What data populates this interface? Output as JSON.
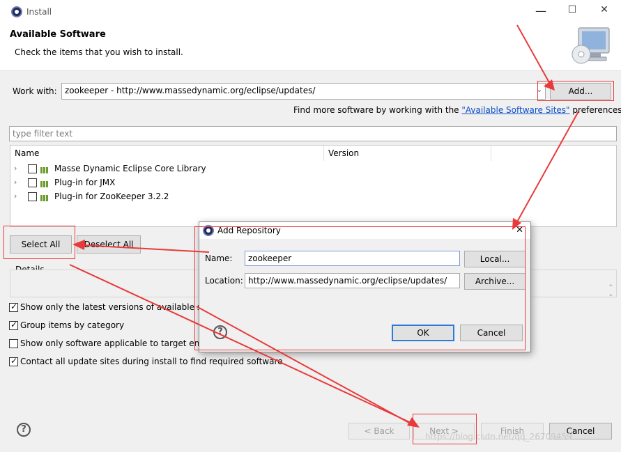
{
  "window": {
    "title": "Install",
    "minimize_glyph": "—",
    "maximize_glyph": "☐",
    "close_glyph": "✕"
  },
  "header": {
    "title": "Available Software",
    "subtitle": "Check the items that you wish to install."
  },
  "work_with": {
    "label": "Work with:",
    "value": "zookeeper - http://www.massedynamic.org/eclipse/updates/",
    "add_button": "Add...",
    "more_prefix": "Find more software by working with the ",
    "more_link": "\"Available Software Sites\"",
    "more_suffix": " preferences."
  },
  "filter": {
    "placeholder": "type filter text"
  },
  "table": {
    "columns": [
      "Name",
      "Version"
    ],
    "rows": [
      {
        "name": "Masse Dynamic Eclipse Core Library",
        "checked": false
      },
      {
        "name": "Plug-in for JMX",
        "checked": false
      },
      {
        "name": "Plug-in for ZooKeeper 3.2.2",
        "checked": false
      }
    ]
  },
  "buttons": {
    "select_all": "Select All",
    "deselect_all": "Deselect All"
  },
  "details": {
    "label": "Details"
  },
  "options": [
    {
      "label": "Show only the latest versions of available software",
      "checked": true
    },
    {
      "label": "Group items by category",
      "checked": true
    },
    {
      "label": "Show only software applicable to target environment",
      "checked": false
    },
    {
      "label": "Contact all update sites during install to find required software",
      "checked": true
    }
  ],
  "footer": {
    "back": "< Back",
    "next": "Next >",
    "finish": "Finish",
    "cancel": "Cancel"
  },
  "dialog": {
    "title": "Add Repository",
    "close_glyph": "✕",
    "name_label": "Name:",
    "name_value": "zookeeper",
    "location_label": "Location:",
    "location_value": "http://www.massedynamic.org/eclipse/updates/",
    "local_button": "Local...",
    "archive_button": "Archive...",
    "ok_button": "OK",
    "cancel_button": "Cancel"
  },
  "watermark": "https://blog.csdn.net/qq_26709459",
  "colors": {
    "annotation_red": "#e83a3a",
    "link_blue": "#0b4fc9",
    "focus_blue": "#2d7bd6"
  }
}
